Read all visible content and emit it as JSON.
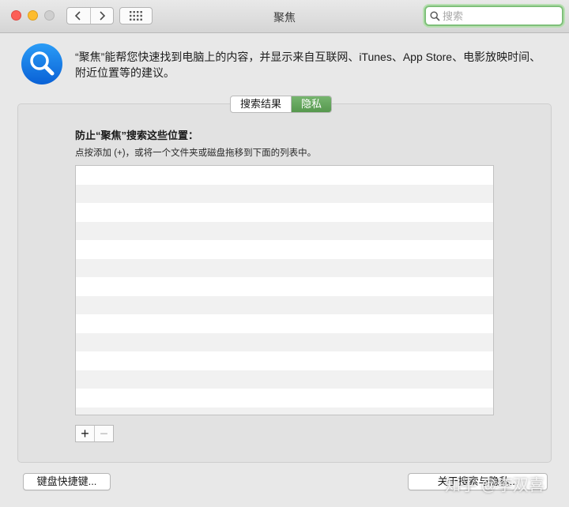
{
  "window": {
    "title": "聚焦"
  },
  "toolbar": {
    "back_icon": "chevron-left-icon",
    "forward_icon": "chevron-right-icon",
    "grid_icon": "grid-icon"
  },
  "search": {
    "placeholder": "搜索",
    "value": ""
  },
  "header": {
    "icon": "spotlight-icon",
    "description": "“聚焦”能帮您快速找到电脑上的内容，并显示来自互联网、iTunes、App Store、电影放映时间、附近位置等的建议。"
  },
  "tabs": [
    {
      "label": "搜索结果",
      "selected": false
    },
    {
      "label": "隐私",
      "selected": true
    }
  ],
  "privacy": {
    "heading": "防止“聚焦”搜索这些位置：",
    "hint": "点按添加 (+)，或将一个文件夹或磁盘拖移到下面的列表中。",
    "items": []
  },
  "list_controls": {
    "add_label": "+",
    "remove_label": "−"
  },
  "buttons": {
    "keyboard_shortcuts": "键盘快捷键...",
    "about": "关于搜索与隐私..."
  },
  "watermark": "知乎 @李双喜",
  "colors": {
    "accent_green": "#5aa152",
    "search_focus": "#7fc07a"
  }
}
